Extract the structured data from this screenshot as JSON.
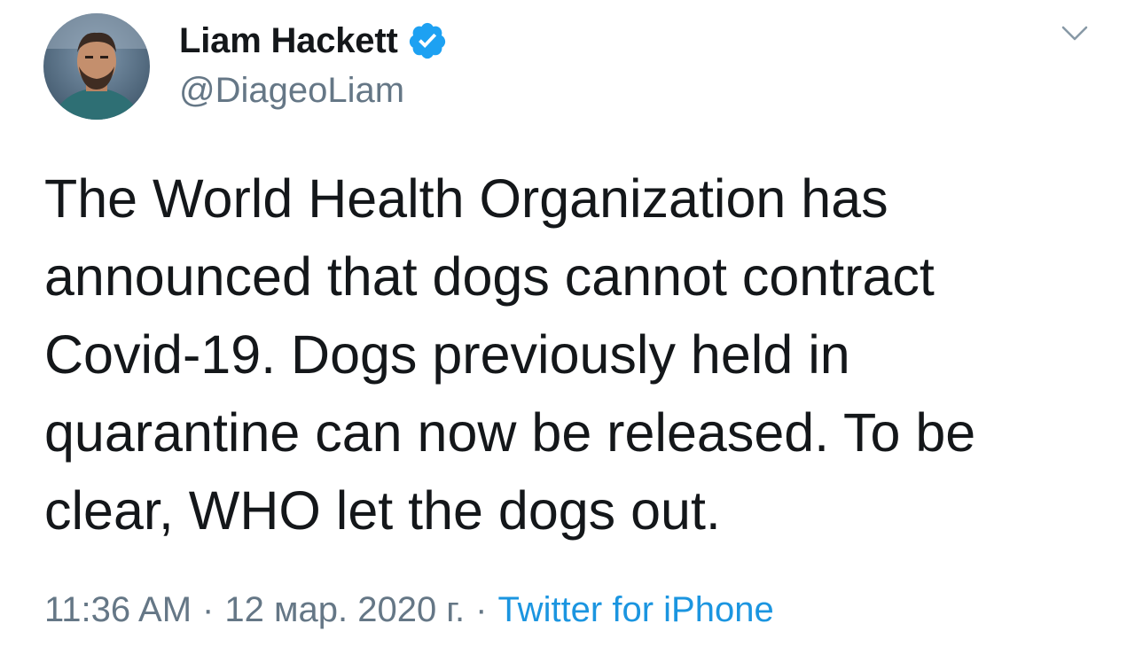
{
  "author": {
    "name": "Liam Hackett",
    "handle": "@DiageoLiam",
    "verified": true,
    "avatar_icon": "profile-photo"
  },
  "menu_icon": "chevron-down-icon",
  "tweet": {
    "lines": [
      "The World Health Organization has",
      "announced that dogs cannot contract",
      "Covid-19. Dogs previously held in",
      "quarantine can now be released. To be",
      "clear, WHO let the dogs out."
    ]
  },
  "meta": {
    "time": "11:36 AM",
    "separator": "·",
    "date": "12 мар. 2020 г.",
    "source": "Twitter for iPhone"
  },
  "colors": {
    "text": "#14171a",
    "secondary": "#657786",
    "accent": "#1b95e0",
    "verified": "#1da1f2"
  }
}
